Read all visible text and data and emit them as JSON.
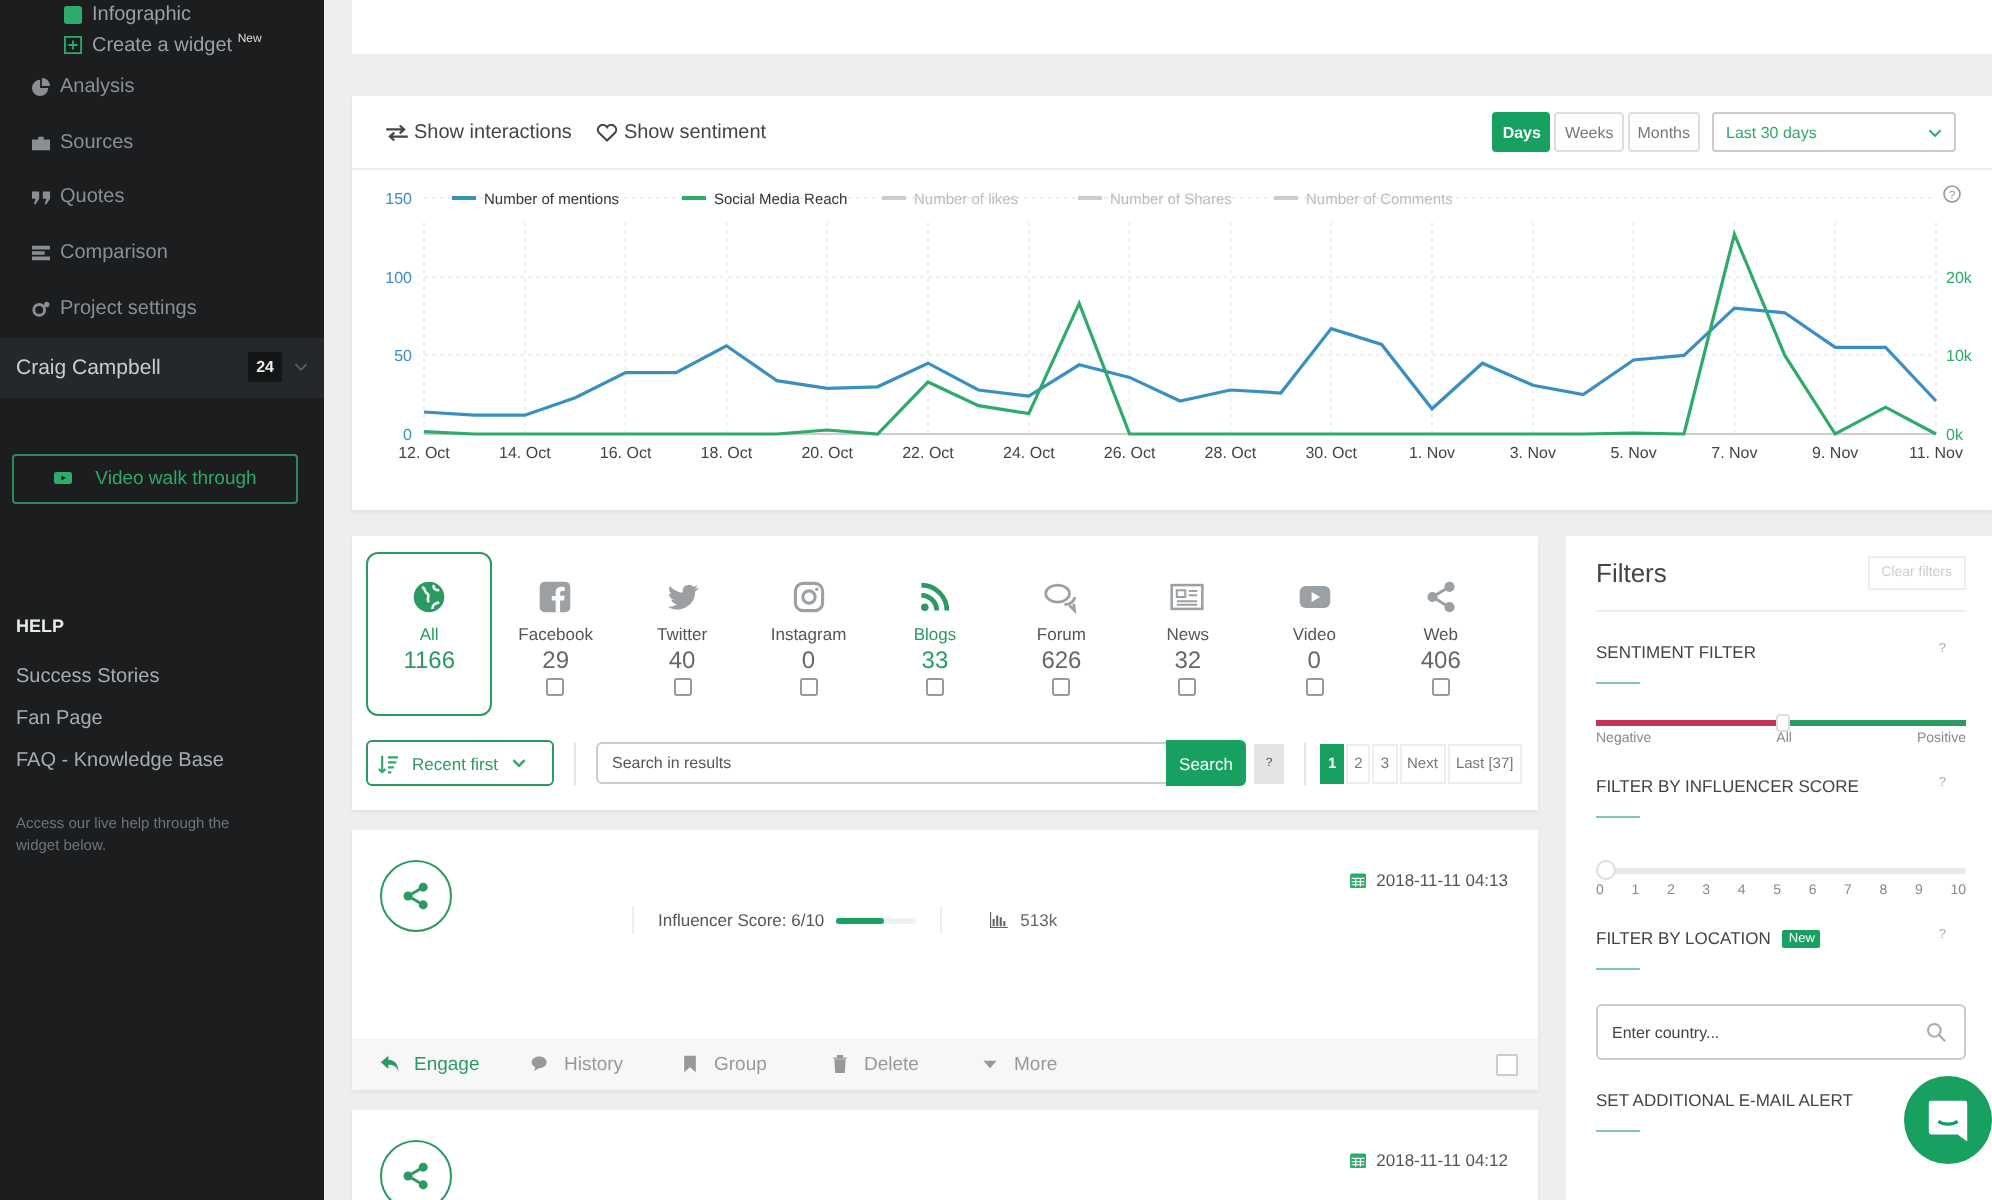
{
  "sidebar": {
    "items": [
      {
        "label": "Infographic",
        "kind": "sub"
      },
      {
        "label": "Create a widget $^{New}$",
        "kind": "sub"
      },
      {
        "label": "Analysis",
        "kind": "main"
      },
      {
        "label": "Sources",
        "kind": "main"
      },
      {
        "label": "Quotes",
        "kind": "main"
      },
      {
        "label": "Comparison",
        "kind": "main"
      },
      {
        "label": "Project settings",
        "kind": "main"
      }
    ],
    "user": {
      "name": "Craig Campbell",
      "badge": "24"
    },
    "video_button": "Video walk through",
    "help": {
      "title": "HELP",
      "links": [
        "Success Stories",
        "Fan Page",
        "FAQ - Knowledge Base"
      ],
      "note": "Access our live help through the widget below."
    }
  },
  "chart_card": {
    "toggles": [
      "Show interactions",
      "Show sentiment"
    ],
    "periods": [
      {
        "label": "Days",
        "selected": true
      },
      {
        "label": "Weeks",
        "selected": false
      },
      {
        "label": "Months",
        "selected": false
      }
    ],
    "range": "Last 30 days",
    "help": "?",
    "inactive_series": [
      "Number of likes",
      "Number of Shares",
      "Number of Comments"
    ],
    "chart_data": {
      "type": "line",
      "grid": true,
      "legend": "top",
      "categories": [
        "12. Oct",
        null,
        "14. Oct",
        null,
        "16. Oct",
        null,
        "18. Oct",
        null,
        "20. Oct",
        null,
        "22. Oct",
        null,
        "24. Oct",
        null,
        "26. Oct",
        null,
        "28. Oct",
        null,
        "30. Oct",
        null,
        "1. Nov",
        null,
        "3. Nov",
        null,
        "5. Nov",
        null,
        "7. Nov",
        null,
        "9. Nov",
        null,
        "11. Nov"
      ],
      "ylim": [
        0,
        150
      ],
      "yticks": [
        0,
        50,
        100,
        150
      ],
      "y2lim": [
        0,
        30000
      ],
      "y2ticks": [
        {
          "value": 0,
          "label": "0k"
        },
        {
          "value": 10000,
          "label": "10k"
        },
        {
          "value": 20000,
          "label": "20k"
        }
      ],
      "series": [
        {
          "name": "Number of mentions",
          "color": "#3a8fc2",
          "values": [
            14,
            12,
            12,
            23,
            39,
            39,
            56,
            34,
            29,
            30,
            45,
            28,
            24,
            44,
            36,
            21,
            28,
            26,
            67,
            57,
            16,
            45,
            31,
            25,
            47,
            50,
            80,
            77,
            55,
            55,
            21
          ]
        },
        {
          "name": "Social Media Reach",
          "color": "#2eaa6a",
          "axis": "y2",
          "values": [
            300,
            0,
            0,
            0,
            0,
            0,
            0,
            0,
            500,
            0,
            6600,
            3600,
            2600,
            16600,
            0,
            0,
            0,
            0,
            0,
            0,
            0,
            0,
            0,
            0,
            100,
            0,
            25400,
            10000,
            0,
            3400,
            0
          ]
        }
      ]
    }
  },
  "sources": [
    {
      "label": "All",
      "count": "1166",
      "selected": true,
      "highlighted": true
    },
    {
      "label": "Facebook",
      "count": "29",
      "selected": false,
      "highlighted": false,
      "checked": false
    },
    {
      "label": "Twitter",
      "count": "40",
      "selected": false,
      "highlighted": false,
      "checked": false
    },
    {
      "label": "Instagram",
      "count": "0",
      "selected": false,
      "highlighted": false,
      "checked": false
    },
    {
      "label": "Blogs",
      "count": "33",
      "selected": false,
      "highlighted": true,
      "checked": false
    },
    {
      "label": "Forum",
      "count": "626",
      "selected": false,
      "highlighted": false,
      "checked": false
    },
    {
      "label": "News",
      "count": "32",
      "selected": false,
      "highlighted": false,
      "checked": false
    },
    {
      "label": "Video",
      "count": "0",
      "selected": false,
      "highlighted": false,
      "checked": false
    },
    {
      "label": "Web",
      "count": "406",
      "selected": false,
      "highlighted": false,
      "checked": false
    }
  ],
  "results_bar": {
    "sort": "Recent first",
    "search_placeholder": "Search in results",
    "search_button": "Search",
    "help": "?",
    "pages": [
      {
        "label": "1",
        "selected": true
      },
      {
        "label": "2",
        "selected": false
      },
      {
        "label": "3",
        "selected": false
      }
    ],
    "next": "Next",
    "last": "Last [37]"
  },
  "posts": [
    {
      "date": "2018-11-11 04:13",
      "influencer": "Influencer Score: 6/10",
      "level": 0.6,
      "reach": "513k",
      "checked": false,
      "actions": [
        {
          "label": "Engage",
          "primary": true
        },
        {
          "label": "History",
          "primary": false
        },
        {
          "label": "Group",
          "primary": false
        },
        {
          "label": "Delete",
          "primary": false
        },
        {
          "label": "More",
          "primary": false
        }
      ]
    },
    {
      "date": "2018-11-11 04:12"
    }
  ],
  "filters": {
    "title": "Filters",
    "clear": "Clear filters",
    "sentiment": {
      "title": "SENTIMENT FILTER",
      "help": "?",
      "level": 0.5,
      "labels": [
        "Negative",
        "All",
        "Positive"
      ]
    },
    "influencer": {
      "title": "FILTER BY INFLUENCER SCORE",
      "help": "?",
      "level": 0,
      "ticks": [
        "0",
        "1",
        "2",
        "3",
        "4",
        "5",
        "6",
        "7",
        "8",
        "9",
        "10"
      ]
    },
    "location": {
      "title": "FILTER BY LOCATION",
      "badge": "New",
      "help": "?",
      "placeholder": "Enter country..."
    },
    "alert": {
      "title": "SET ADDITIONAL E-MAIL ALERT"
    }
  }
}
